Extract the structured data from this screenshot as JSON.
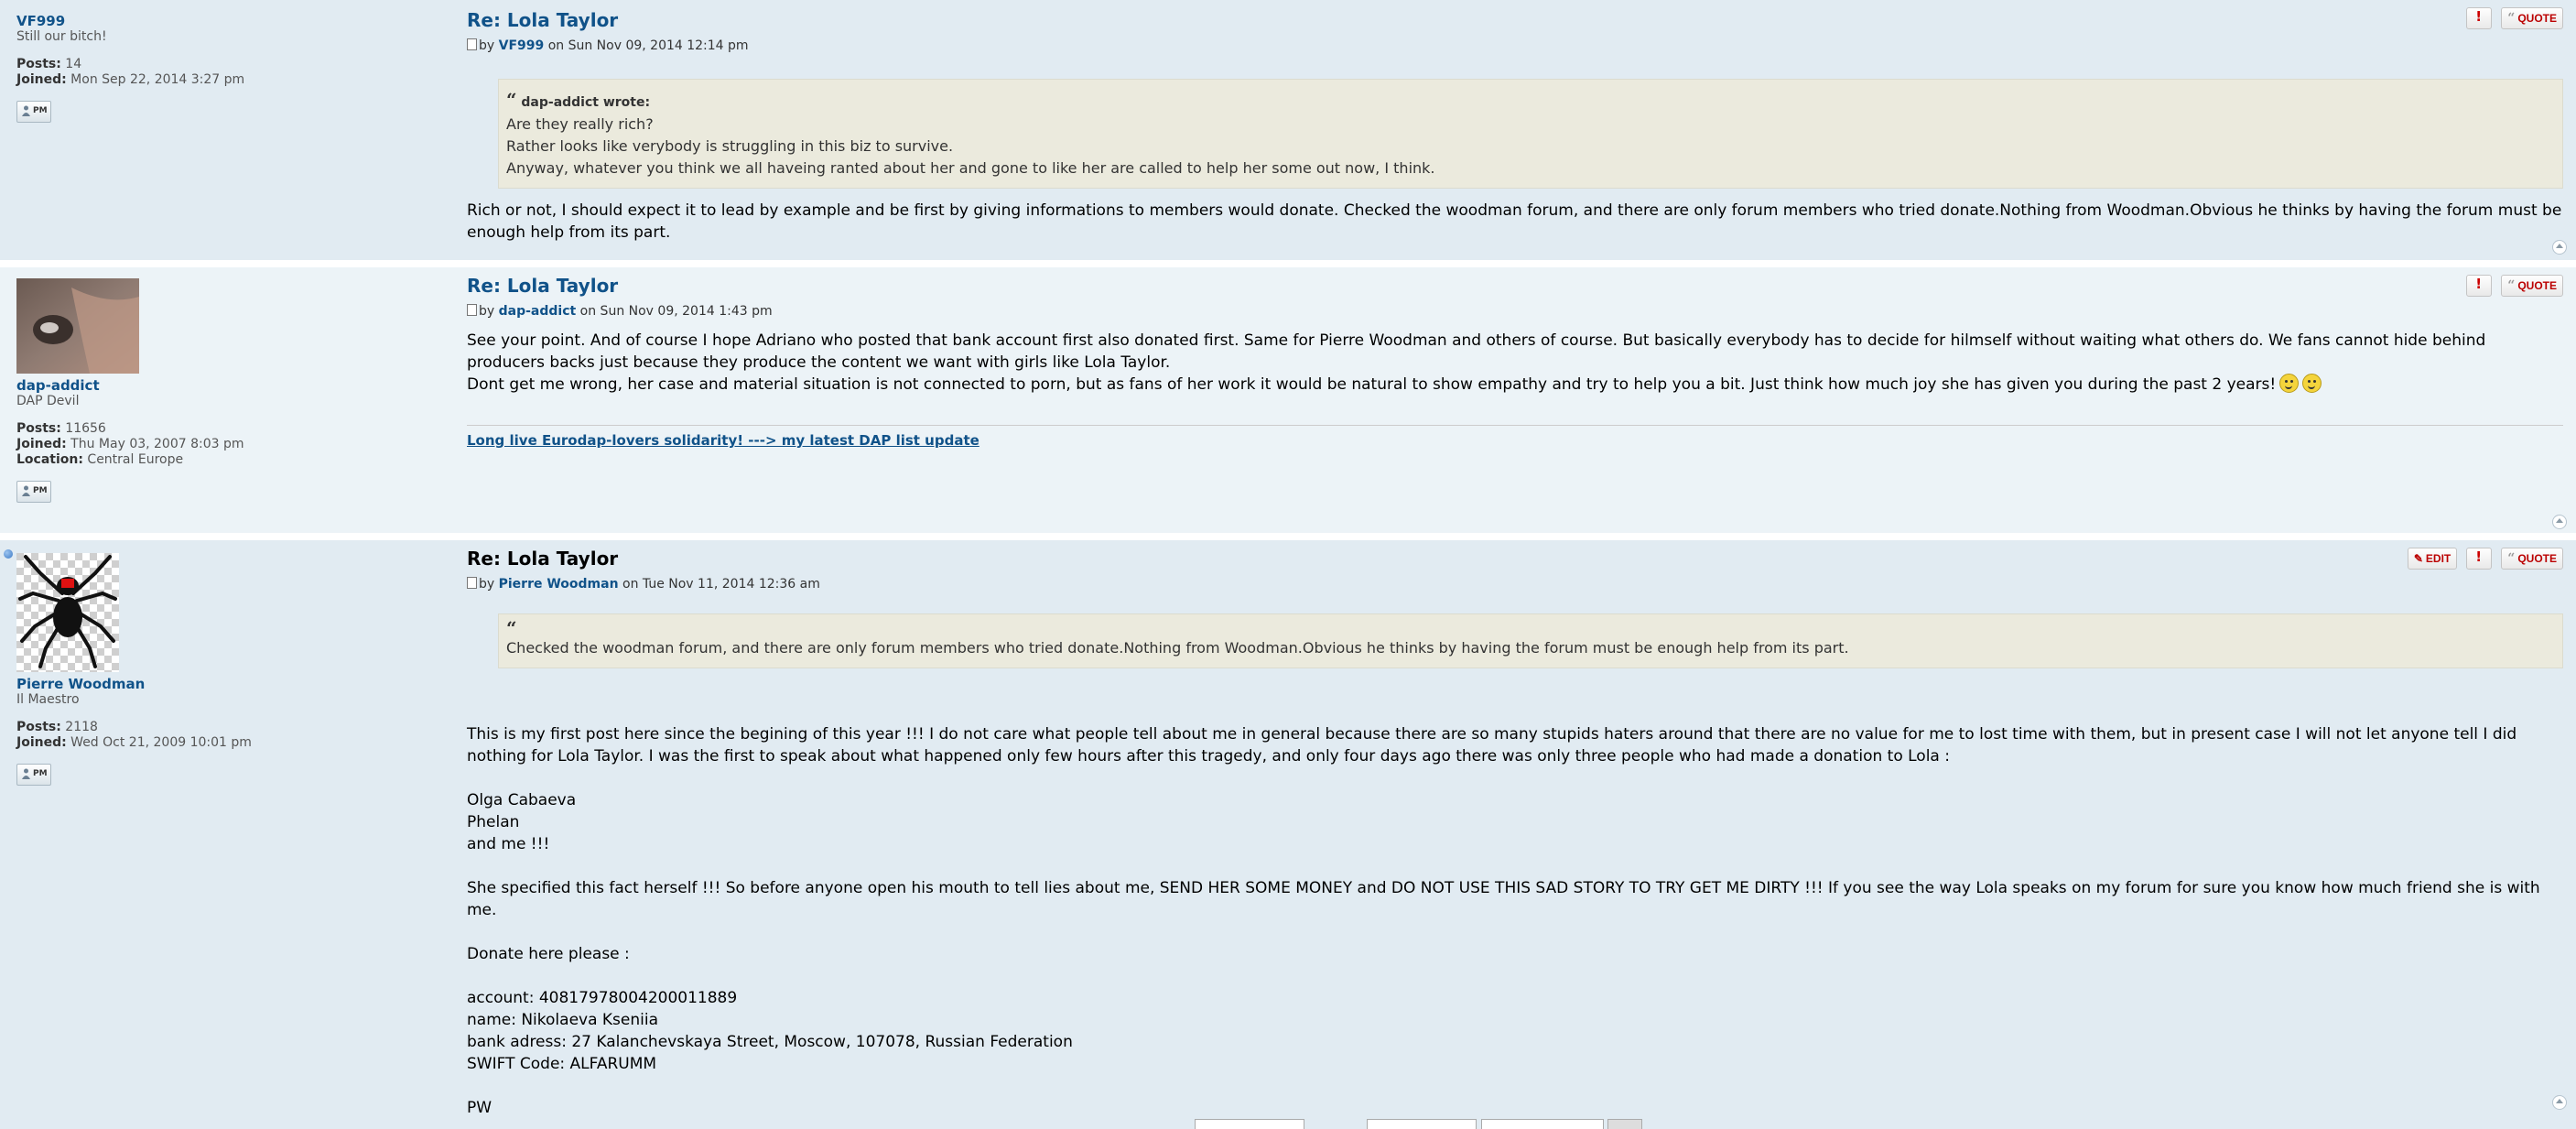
{
  "posts": [
    {
      "author": "VF999",
      "rank": "Still our bitch!",
      "posts_label": "Posts:",
      "posts_count": "14",
      "joined_label": "Joined:",
      "joined": "Mon Sep 22, 2014 3:27 pm",
      "pm_label": "PM",
      "title": "Re: Lola Taylor",
      "by": "by",
      "author_link": "VF999",
      "on_date": "on Sun Nov 09, 2014 12:14 pm",
      "quote_cite": "dap-addict wrote:",
      "quote_lines": [
        "Are they really rich?",
        "Rather looks like verybody is struggling in this biz to survive.",
        "Anyway, whatever you think we all haveing ranted about her and gone to like her are called to help her some out now, I think."
      ],
      "content": [
        "Rich or not, I should expect it to lead by example and be first by giving informations to members would donate. Checked the woodman forum, and there are only forum members who tried donate.Nothing from Woodman.Obvious he thinks by having the forum must be enough help from its part."
      ],
      "quote_btn": "QUOTE"
    },
    {
      "author": "dap-addict",
      "rank": "DAP Devil",
      "posts_label": "Posts:",
      "posts_count": "11656",
      "joined_label": "Joined:",
      "joined": "Thu May 03, 2007 8:03 pm",
      "location_label": "Location:",
      "location": "Central Europe",
      "pm_label": "PM",
      "title": "Re: Lola Taylor",
      "by": "by",
      "author_link": "dap-addict",
      "on_date": "on Sun Nov 09, 2014 1:43 pm",
      "content": [
        "See your point. And of course I hope Adriano who posted that bank account first also donated first. Same for Pierre Woodman and others of course. But basically everybody has to decide for hilmself without waiting what others do. We fans cannot hide behind producers backs just because they produce the content we want with girls like Lola Taylor.",
        "Dont get me wrong, her case and material situation is not connected to porn, but as fans of her work it would be natural to show empathy and try to help you a bit. Just think how much joy she has given you during the past 2 years!"
      ],
      "signature": "Long live Eurodap-lovers solidarity! ---> my latest DAP list update",
      "quote_btn": "QUOTE"
    },
    {
      "author": "Pierre Woodman",
      "rank": "Il Maestro",
      "posts_label": "Posts:",
      "posts_count": "2118",
      "joined_label": "Joined:",
      "joined": "Wed Oct 21, 2009 10:01 pm",
      "pm_label": "PM",
      "title": "Re: Lola Taylor",
      "by": "by",
      "author_link": "Pierre Woodman",
      "on_date": "on Tue Nov 11, 2014 12:36 am",
      "quote_mark": "“",
      "quote_text": "Checked the woodman forum, and there are only forum members who tried donate.Nothing from Woodman.Obvious he thinks by having the forum must be enough help from its part.",
      "para1": "This is my first post here since the begining of this year !!! I do not care what people tell about me in general because there are so many stupids haters around that there are no value for me to lost time with them, but in present case I will not let anyone tell I did nothing for Lola Taylor. I was the first to speak about what happened only few hours after this tragedy, and only four days ago there was only three people who had made a donation to Lola :",
      "list": [
        "Olga Cabaeva",
        "Phelan",
        "and me !!!"
      ],
      "para2": "She specified this fact herself !!! So before anyone open his mouth to tell lies about me, SEND HER SOME MONEY and DO NOT USE THIS SAD STORY TO TRY GET ME DIRTY !!! If you see the way Lola speaks on my forum for sure you know how much friend she is with me.",
      "donate": "Donate here please :",
      "bank": [
        "account: 40817978004200011889",
        "name: Nikolaeva Kseniia",
        "bank adress: 27 Kalanchevskaya Street, Moscow, 107078, Russian Federation",
        "SWIFT Code: ALFARUMM"
      ],
      "sign": "PW",
      "edit_btn": "EDIT",
      "quote_btn": "QUOTE"
    }
  ]
}
